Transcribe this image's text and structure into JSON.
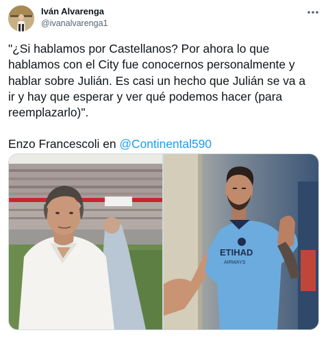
{
  "author": {
    "name": "Iván Alvarenga",
    "handle": "@ivanalvarenga1"
  },
  "tweet": {
    "lines": [
      "\"¿Si hablamos por Castellanos? Por ahora lo que",
      "hablamos con el City fue conocernos personalmente y",
      "hablar sobre Julián. Es casi un hecho que Julián se va a",
      "ir y hay que esperar y ver qué podemos hacer (para",
      "reemplazarlo)\"."
    ],
    "attribution_prefix": "Enzo Francescoli en ",
    "mention": "@Continental590"
  },
  "media": {
    "photo_right_shirt_text": "ETIHAD",
    "photo_right_shirt_subtext": "AIRWAYS"
  },
  "icons": {
    "more": "more-horizontal-icon"
  },
  "colors": {
    "link": "#1d9bf0",
    "text": "#0f1419",
    "secondary": "#536471",
    "border": "#cfd9de",
    "nycfc_blue": "#6cabdd"
  }
}
